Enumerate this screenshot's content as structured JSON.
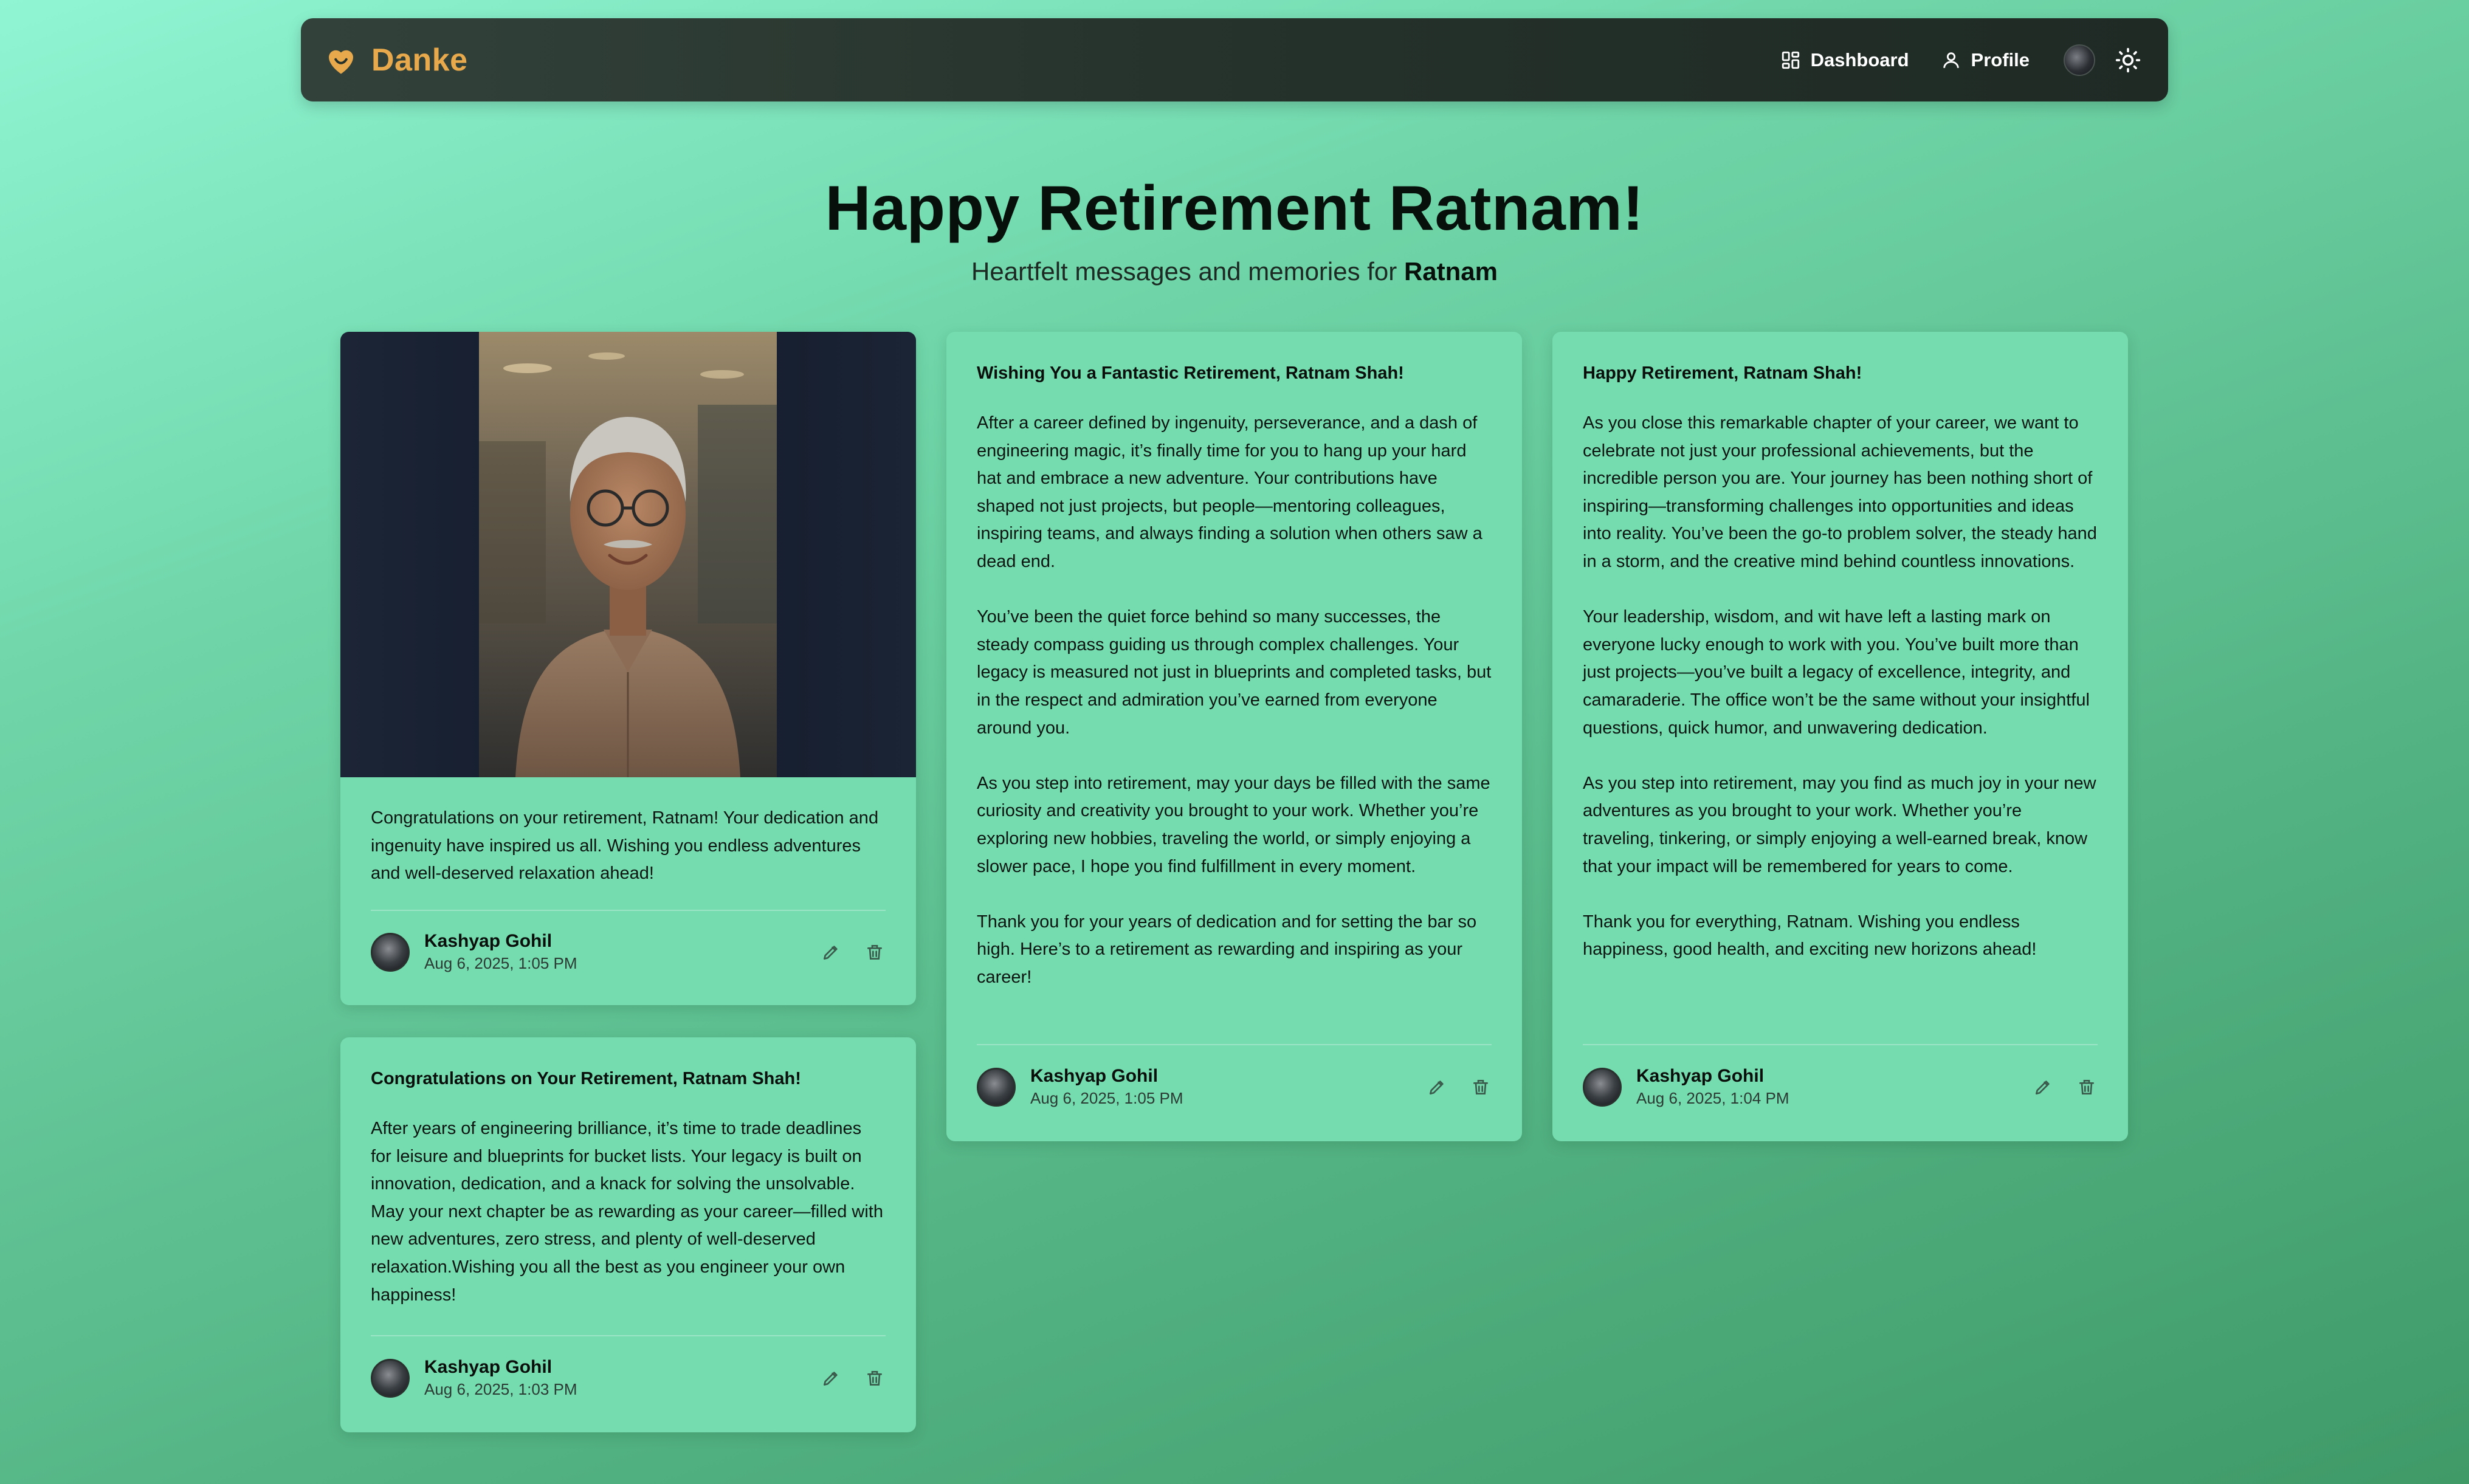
{
  "nav": {
    "brand": "Danke",
    "dashboard_label": "Dashboard",
    "profile_label": "Profile"
  },
  "header": {
    "title": "Happy Retirement Ratnam!",
    "subtitle_prefix": "Heartfelt messages and memories for ",
    "subtitle_name": "Ratnam"
  },
  "cards": [
    {
      "title": "",
      "paragraphs": [
        "Congratulations on your retirement, Ratnam! Your dedication and ingenuity have inspired us all. Wishing you endless adventures and well-deserved relaxation ahead!"
      ],
      "author": "Kashyap Gohil",
      "date": "Aug 6, 2025, 1:05 PM",
      "has_photo": true
    },
    {
      "title": "Congratulations on Your Retirement, Ratnam Shah!",
      "paragraphs": [
        "After years of engineering brilliance, it’s time to trade deadlines for leisure and blueprints for bucket lists. Your legacy is built on innovation, dedication, and a knack for solving the unsolvable. May your next chapter be as rewarding as your career—filled with new adventures, zero stress, and plenty of well-deserved relaxation.Wishing you all the best as you engineer your own happiness!"
      ],
      "author": "Kashyap Gohil",
      "date": "Aug 6, 2025, 1:03 PM"
    },
    {
      "title": "Wishing You a Fantastic Retirement, Ratnam Shah!",
      "paragraphs": [
        "After a career defined by ingenuity, perseverance, and a dash of engineering magic, it’s finally time for you to hang up your hard hat and embrace a new adventure. Your contributions have shaped not just projects, but people—mentoring colleagues, inspiring teams, and always finding a solution when others saw a dead end.",
        "You’ve been the quiet force behind so many successes, the steady compass guiding us through complex challenges. Your legacy is measured not just in blueprints and completed tasks, but in the respect and admiration you’ve earned from everyone around you.",
        "As you step into retirement, may your days be filled with the same curiosity and creativity you brought to your work. Whether you’re exploring new hobbies, traveling the world, or simply enjoying a slower pace, I hope you find fulfillment in every moment.",
        "Thank you for your years of dedication and for setting the bar so high. Here’s to a retirement as rewarding and inspiring as your career!"
      ],
      "author": "Kashyap Gohil",
      "date": "Aug 6, 2025, 1:05 PM"
    },
    {
      "title": "Happy Retirement, Ratnam Shah!",
      "paragraphs": [
        "As you close this remarkable chapter of your career, we want to celebrate not just your professional achievements, but the incredible person you are. Your journey has been nothing short of inspiring—transforming challenges into opportunities and ideas into reality. You’ve been the go-to problem solver, the steady hand in a storm, and the creative mind behind countless innovations.",
        "Your leadership, wisdom, and wit have left a lasting mark on everyone lucky enough to work with you. You’ve built more than just projects—you’ve built a legacy of excellence, integrity, and camaraderie. The office won’t be the same without your insightful questions, quick humor, and unwavering dedication.",
        "As you step into retirement, may you find as much joy in your new adventures as you brought to your work. Whether you’re traveling, tinkering, or simply enjoying a well-earned break, know that your impact will be remembered for years to come.",
        "Thank you for everything, Ratnam. Wishing you endless happiness, good health, and exciting new horizons ahead!"
      ],
      "author": "Kashyap Gohil",
      "date": "Aug 6, 2025, 1:04 PM"
    }
  ],
  "colors": {
    "brand": "#e7a94c",
    "card_bg": "#75dcb0",
    "nav_bg": "#24302a"
  },
  "icons": [
    "heart-icon",
    "dashboard-icon",
    "profile-icon",
    "sun-icon",
    "edit-icon",
    "delete-icon"
  ]
}
